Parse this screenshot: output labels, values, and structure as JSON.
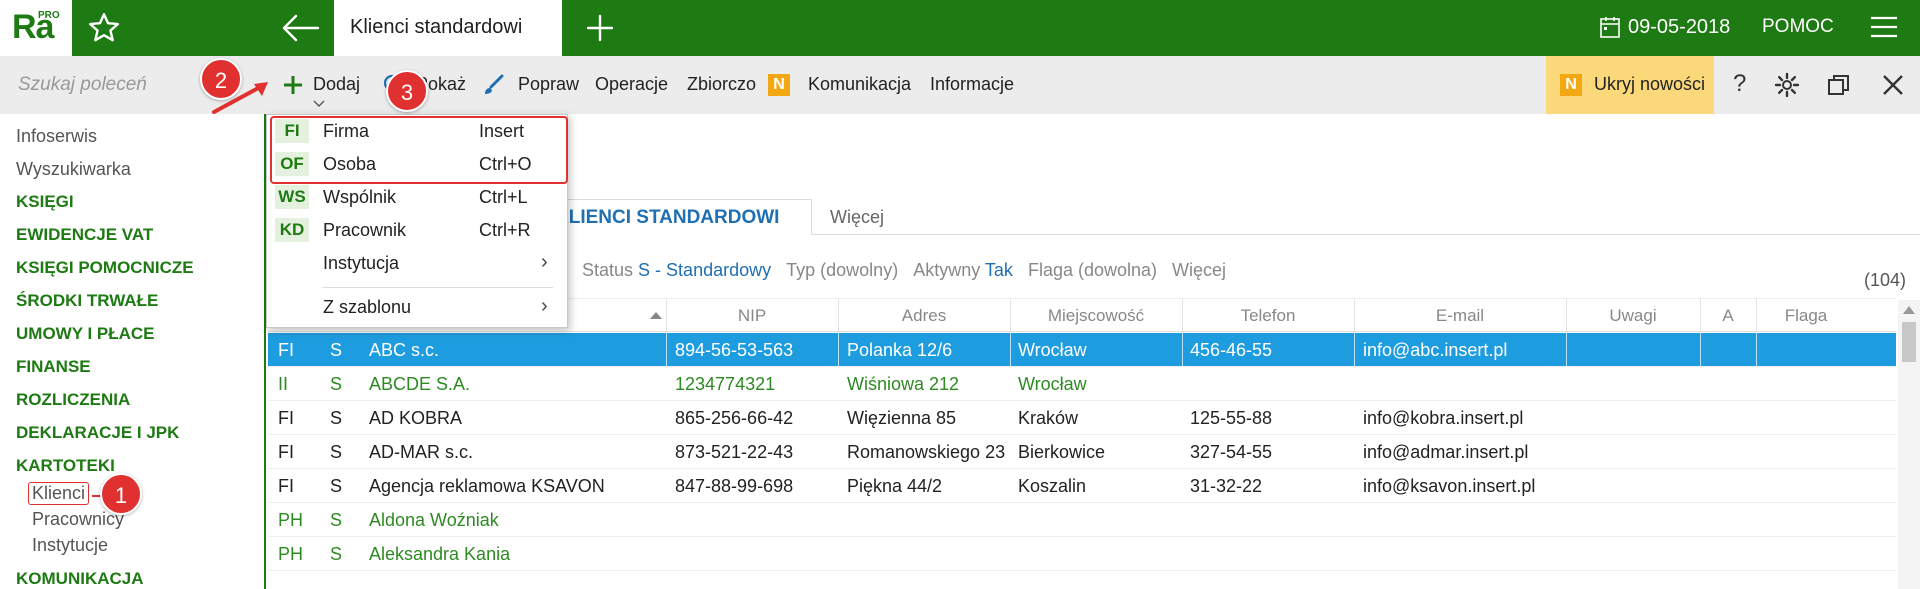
{
  "app": {
    "logo": "Ra",
    "logo_sup": "PRO"
  },
  "header": {
    "tab_title": "Klienci standardowi",
    "date": "09-05-2018",
    "help": "POMOC"
  },
  "toolbar": {
    "search_placeholder": "Szukaj poleceń",
    "dodaj": "Dodaj",
    "pokaz": "Pokaż",
    "popraw": "Popraw",
    "operacje": "Operacje",
    "zbiorczo": "Zbiorczo",
    "n_badge": "N",
    "komunikacja": "Komunikacja",
    "informacje": "Informacje",
    "ukryj_nowosci": "Ukryj nowości",
    "help_icon": "?"
  },
  "sidebar": {
    "items": [
      {
        "label": "Infoserwis",
        "kind": "plain"
      },
      {
        "label": "Wyszukiwarka",
        "kind": "plain"
      },
      {
        "label": "KSIĘGI",
        "kind": "cat"
      },
      {
        "label": "EWIDENCJE VAT",
        "kind": "cat"
      },
      {
        "label": "KSIĘGI POMOCNICZE",
        "kind": "cat"
      },
      {
        "label": "ŚRODKI TRWAŁE",
        "kind": "cat"
      },
      {
        "label": "UMOWY I PŁACE",
        "kind": "cat"
      },
      {
        "label": "FINANSE",
        "kind": "cat"
      },
      {
        "label": "ROZLICZENIA",
        "kind": "cat"
      },
      {
        "label": "DEKLARACJE I JPK",
        "kind": "cat"
      },
      {
        "label": "KARTOTEKI",
        "kind": "cat"
      }
    ],
    "sub": [
      "Klienci",
      "Pracownicy",
      "Instytucje"
    ],
    "last": "KOMUNIKACJA"
  },
  "dropdown": {
    "items": [
      {
        "code": "FI",
        "label": "Firma",
        "key": "Insert"
      },
      {
        "code": "OF",
        "label": "Osoba",
        "key": "Ctrl+O"
      },
      {
        "code": "WS",
        "label": "Wspólnik",
        "key": "Ctrl+L"
      },
      {
        "code": "KD",
        "label": "Pracownik",
        "key": "Ctrl+R"
      },
      {
        "code": "",
        "label": "Instytucja",
        "key": ""
      },
      {
        "code": "",
        "label": "Z szablonu",
        "key": ""
      }
    ],
    "arrow": "›"
  },
  "main": {
    "tab_active": "KLIENCI STANDARDOWI",
    "tab_more": "Więcej",
    "filters": {
      "status_label": "Status",
      "status_value": "S - Standardowy",
      "typ": "Typ (dowolny)",
      "aktywny_label": "Aktywny",
      "aktywny_value": "Tak",
      "flaga": "Flaga (dowolna)",
      "wiecej": "Więcej"
    },
    "count": "(104)"
  },
  "table": {
    "columns": [
      "NIP",
      "Adres",
      "Miejscowość",
      "Telefon",
      "E-mail",
      "Uwagi",
      "A",
      "Flaga"
    ],
    "rows": [
      {
        "t": "FI",
        "s": "S",
        "name": "ABC s.c.",
        "nip": "894-56-53-563",
        "addr": "Polanka  12/6",
        "city": "Wrocław",
        "tel": "456-46-55",
        "email": "info@abc.insert.pl",
        "style": "sel"
      },
      {
        "t": "II",
        "s": "S",
        "name": "ABCDE S.A.",
        "nip": "1234774321",
        "addr": "Wiśniowa 212",
        "city": "Wrocław",
        "tel": "",
        "email": "",
        "style": "green"
      },
      {
        "t": "FI",
        "s": "S",
        "name": "AD KOBRA",
        "nip": "865-256-66-42",
        "addr": "Więzienna  85",
        "city": "Kraków",
        "tel": "125-55-88",
        "email": "info@kobra.insert.pl",
        "style": "dark"
      },
      {
        "t": "FI",
        "s": "S",
        "name": "AD-MAR s.c.",
        "nip": "873-521-22-43",
        "addr": "Romanowskiego 23",
        "city": "Bierkowice",
        "tel": "327-54-55",
        "email": "info@admar.insert.pl",
        "style": "dark"
      },
      {
        "t": "FI",
        "s": "S",
        "name": "Agencja reklamowa KSAVON",
        "nip": "847-88-99-698",
        "addr": "Piękna  44/2",
        "city": "Koszalin",
        "tel": "31-32-22",
        "email": "info@ksavon.insert.pl",
        "style": "dark"
      },
      {
        "t": "PH",
        "s": "S",
        "name": "Aldona Woźniak",
        "nip": "",
        "addr": "",
        "city": "",
        "tel": "",
        "email": "",
        "style": "green"
      },
      {
        "t": "PH",
        "s": "S",
        "name": "Aleksandra Kania",
        "nip": "",
        "addr": "",
        "city": "",
        "tel": "",
        "email": "",
        "style": "green"
      }
    ]
  },
  "callouts": [
    "1",
    "2",
    "3"
  ],
  "colors": {
    "brand_green": "#1e7a12",
    "selection_blue": "#1e9ce0",
    "accent_orange": "#f3a712",
    "callout_red": "#e03030"
  }
}
